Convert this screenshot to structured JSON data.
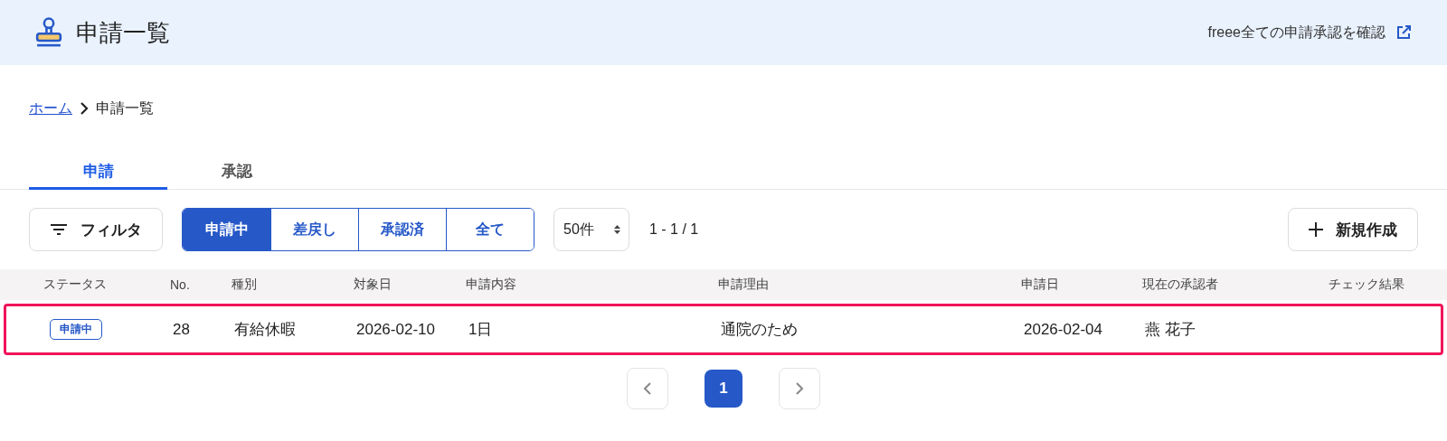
{
  "header": {
    "title": "申請一覧",
    "link": "freee全ての申請承認を確認"
  },
  "breadcrumb": {
    "home": "ホーム",
    "current": "申請一覧"
  },
  "tabs": [
    {
      "label": "申請",
      "selected": true
    },
    {
      "label": "承認",
      "selected": false
    }
  ],
  "toolbar": {
    "filter": "フィルタ",
    "segments": [
      {
        "label": "申請中",
        "selected": true
      },
      {
        "label": "差戻し",
        "selected": false
      },
      {
        "label": "承認済",
        "selected": false
      },
      {
        "label": "全て",
        "selected": false
      }
    ],
    "per_page": "50件",
    "range": "1 - 1 / 1",
    "create": "新規作成"
  },
  "table": {
    "columns": [
      "ステータス",
      "No.",
      "種別",
      "対象日",
      "申請内容",
      "申請理由",
      "申請日",
      "現在の承認者",
      "チェック結果"
    ],
    "rows": [
      {
        "highlighted": true,
        "status": "申請中",
        "no": "28",
        "type": "有給休暇",
        "date": "2026-02-10",
        "content": "1日",
        "reason": "通院のため",
        "applied": "2026-02-04",
        "approver": "燕 花子"
      }
    ]
  },
  "pagination": {
    "pages": [
      {
        "label": "1",
        "selected": true
      }
    ]
  }
}
